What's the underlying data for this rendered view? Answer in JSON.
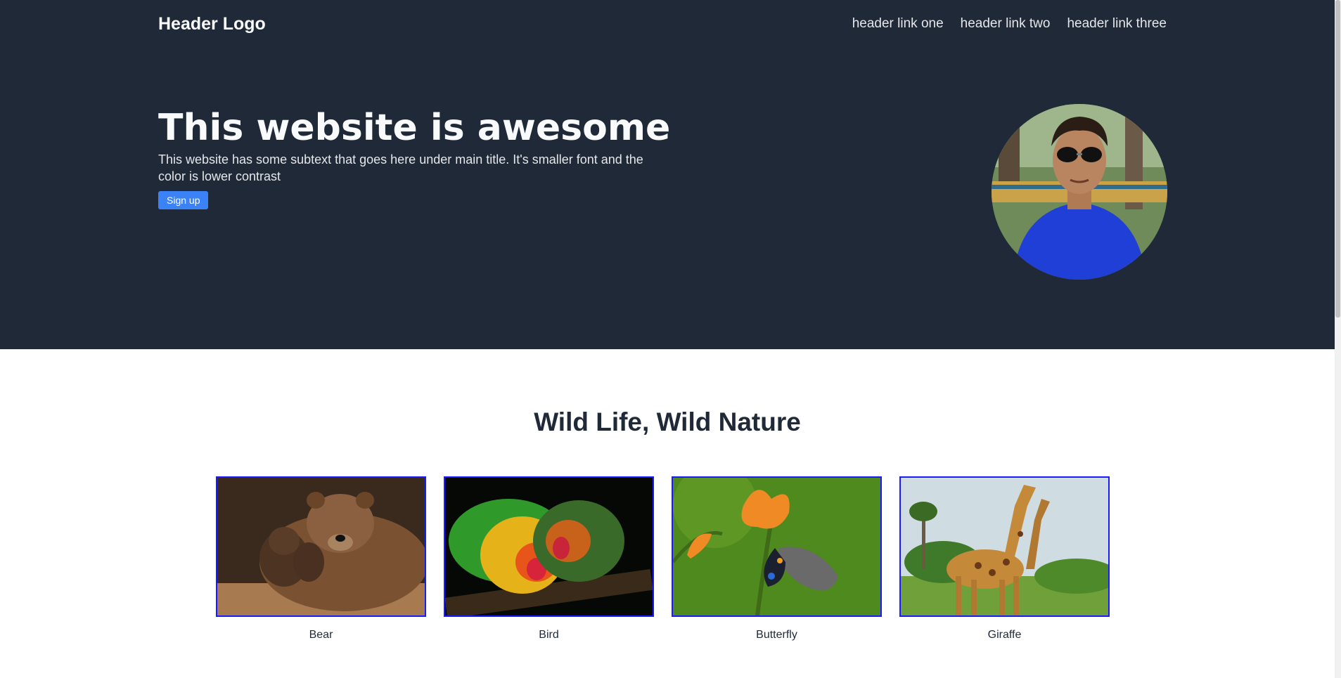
{
  "header": {
    "logo": "Header Logo",
    "links": [
      "header link one",
      "header link two",
      "header link three"
    ]
  },
  "hero": {
    "title": "This website is awesome",
    "subtitle": "This website has some subtext that goes here under main title. It's smaller font and the color is lower contrast",
    "button_label": "Sign up"
  },
  "gallery": {
    "title": "Wild Life, Wild Nature",
    "items": [
      {
        "caption": "Bear"
      },
      {
        "caption": "Bird"
      },
      {
        "caption": "Butterfly"
      },
      {
        "caption": "Giraffe"
      }
    ]
  },
  "colors": {
    "hero_bg": "#1f2937",
    "button": "#3b82f6",
    "card_border": "#1a1aff"
  }
}
